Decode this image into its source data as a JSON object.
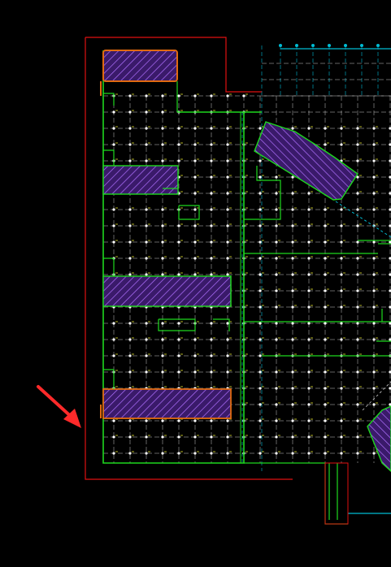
{
  "canvas": {
    "background": "#000000"
  },
  "colors": {
    "grid_white": "#c8c8c8",
    "grid_cyan": "#00bcd4",
    "boundary_red": "#e01010",
    "wall_green": "#1ed81e",
    "core_orange": "#e06a10",
    "hatch_fill": "#3a1a6a",
    "hatch_line": "#b070ff",
    "arrow_red": "#ff2a2a",
    "dim_yellow": "#ffff33"
  },
  "icons": {
    "annotation_arrow": "red-arrow-icon"
  }
}
